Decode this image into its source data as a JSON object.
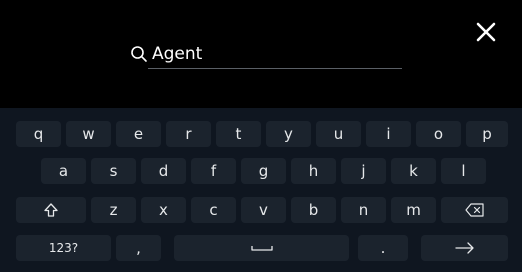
{
  "search": {
    "value": "Agent",
    "icon": "search-icon"
  },
  "close_icon": "close-icon",
  "keyboard": {
    "row1": [
      "q",
      "w",
      "e",
      "r",
      "t",
      "y",
      "u",
      "i",
      "o",
      "p"
    ],
    "row2": [
      "a",
      "s",
      "d",
      "f",
      "g",
      "h",
      "j",
      "k",
      "l"
    ],
    "row3_letters": [
      "z",
      "x",
      "c",
      "v",
      "b",
      "n",
      "m"
    ],
    "shift_icon": "shift-icon",
    "backspace_icon": "backspace-icon",
    "numbers_label": "123?",
    "comma_label": ",",
    "period_label": ".",
    "space_icon": "space-icon",
    "enter_icon": "arrow-right-icon"
  },
  "colors": {
    "background": "#000000",
    "keyboard_background": "#0f1620",
    "key_background": "#1b232d",
    "text": "#ffffff"
  }
}
